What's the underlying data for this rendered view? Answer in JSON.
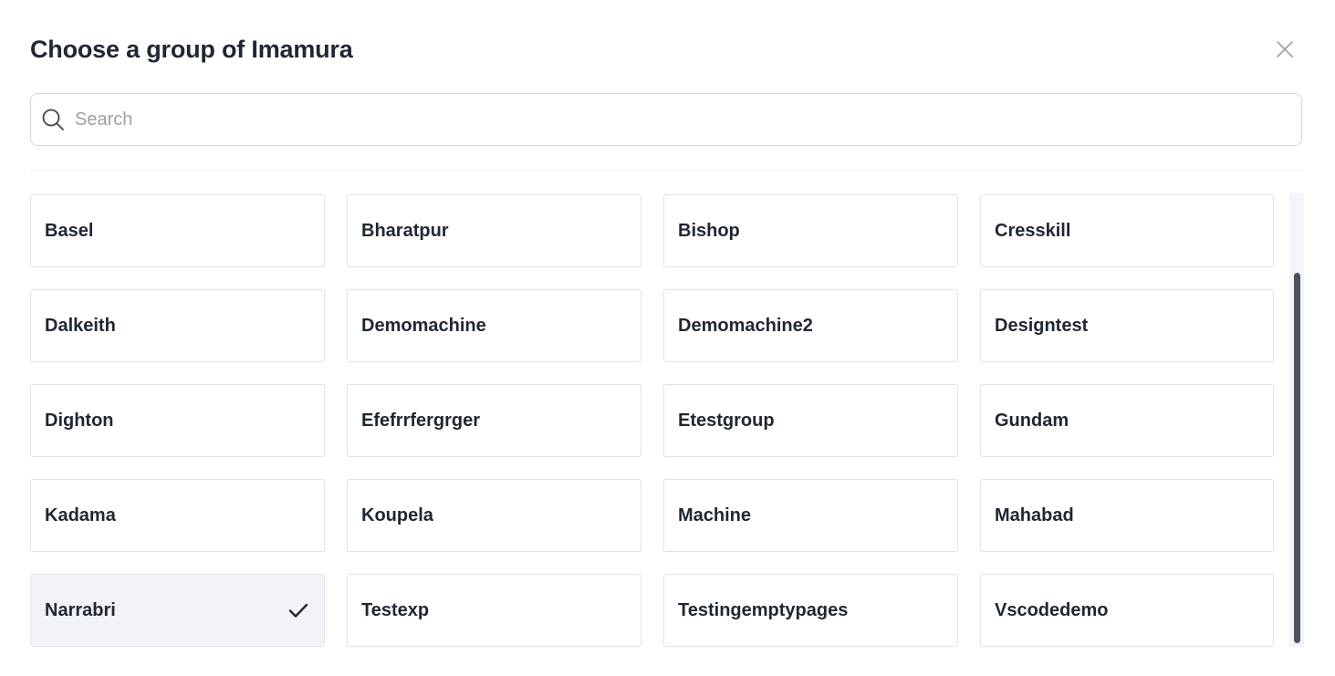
{
  "dialog": {
    "title": "Choose a group of Imamura",
    "close_icon": "close-icon"
  },
  "search": {
    "placeholder": "Search",
    "value": "",
    "icon": "search-icon"
  },
  "groups": [
    {
      "label": "Basel",
      "selected": false
    },
    {
      "label": "Bharatpur",
      "selected": false
    },
    {
      "label": "Bishop",
      "selected": false
    },
    {
      "label": "Cresskill",
      "selected": false
    },
    {
      "label": "Dalkeith",
      "selected": false
    },
    {
      "label": "Demomachine",
      "selected": false
    },
    {
      "label": "Demomachine2",
      "selected": false
    },
    {
      "label": "Designtest",
      "selected": false
    },
    {
      "label": "Dighton",
      "selected": false
    },
    {
      "label": "Efefrrfergrger",
      "selected": false
    },
    {
      "label": "Etestgroup",
      "selected": false
    },
    {
      "label": "Gundam",
      "selected": false
    },
    {
      "label": "Kadama",
      "selected": false
    },
    {
      "label": "Koupela",
      "selected": false
    },
    {
      "label": "Machine",
      "selected": false
    },
    {
      "label": "Mahabad",
      "selected": false
    },
    {
      "label": "Narrabri",
      "selected": true
    },
    {
      "label": "Testexp",
      "selected": false
    },
    {
      "label": "Testingemptypages",
      "selected": false
    },
    {
      "label": "Vscodedemo",
      "selected": false
    }
  ],
  "colors": {
    "text": "#1f2733",
    "selected_bg": "#f2f3f6",
    "border": "#dfe2e7",
    "scroll_thumb": "#4a5261"
  }
}
